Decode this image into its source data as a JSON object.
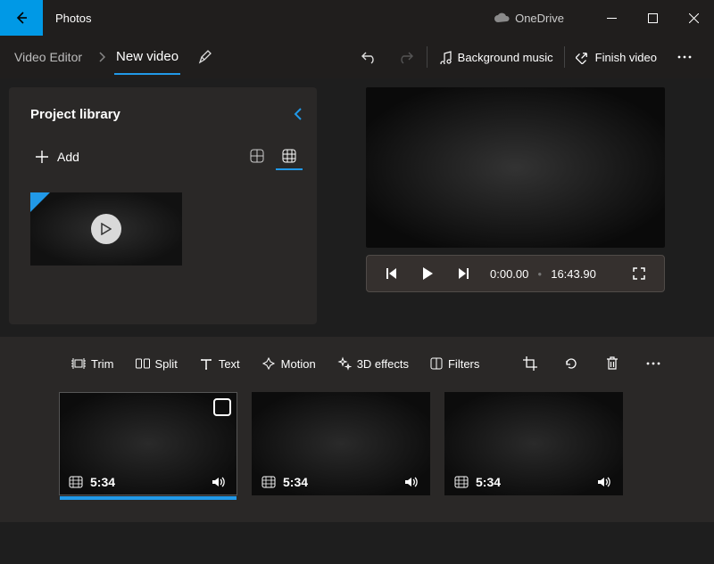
{
  "app": {
    "title": "Photos"
  },
  "cloud": {
    "label": "OneDrive"
  },
  "breadcrumb": {
    "root": "Video Editor",
    "current": "New video"
  },
  "toolbar": {
    "bg_music": "Background music",
    "finish": "Finish video"
  },
  "library": {
    "title": "Project library",
    "add": "Add"
  },
  "player": {
    "current": "0:00.00",
    "total": "16:43.90"
  },
  "storyboard": {
    "tools": {
      "trim": "Trim",
      "split": "Split",
      "text": "Text",
      "motion": "Motion",
      "fx3d": "3D effects",
      "filters": "Filters"
    },
    "clips": [
      {
        "duration": "5:34",
        "selected": true
      },
      {
        "duration": "5:34",
        "selected": false
      },
      {
        "duration": "5:34",
        "selected": false
      }
    ]
  }
}
